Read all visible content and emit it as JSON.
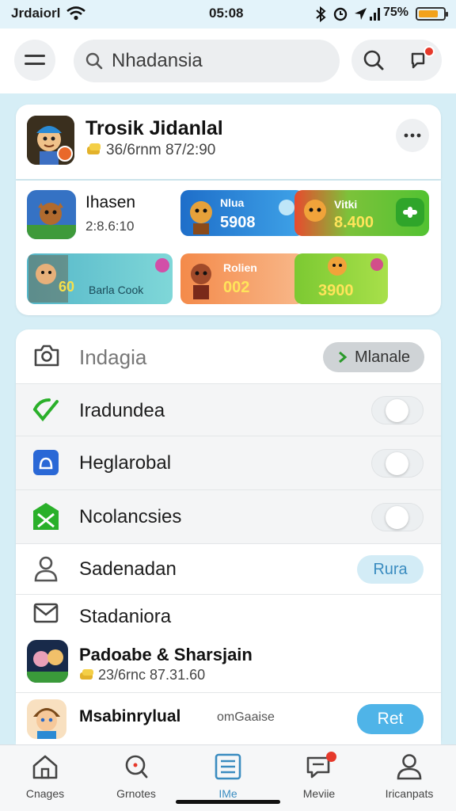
{
  "status_bar": {
    "carrier": "Jrdaiorl",
    "time": "05:08",
    "battery_pct": "75%",
    "battery_level": 0.75
  },
  "header": {
    "search_placeholder": "Nhadansia",
    "icons": [
      "menu-icon",
      "search-icon",
      "notification-icon"
    ]
  },
  "profile": {
    "title": "Trosik Jidanlal",
    "subtitle": "36/6rnm 87/2:90"
  },
  "games": {
    "featured": {
      "title": "Ihasen",
      "subtitle": "2:8.6:10"
    },
    "tiles": [
      {
        "label": "Nlua",
        "value": "5908"
      },
      {
        "label": "Vitki",
        "value": "8.400"
      },
      {
        "label": "Barla Cook",
        "value": "60"
      },
      {
        "label": "Rolien",
        "value": "002"
      },
      {
        "label": "",
        "value": "3900"
      }
    ]
  },
  "settings": {
    "header_label": "Indagia",
    "header_button": "Mlanale",
    "rows": [
      {
        "label": "Iradundea"
      },
      {
        "label": "Heglarobal"
      },
      {
        "label": "Ncolancsies"
      },
      {
        "label": "Sadenadan",
        "button": "Rura"
      },
      {
        "label": "Stadaniora"
      }
    ],
    "app_item": {
      "title": "Padoabe & Sharsjain",
      "subtitle": "23/6rnc 87.31.60"
    },
    "user_item": {
      "title": "Msabinrylual",
      "extra": "omGaaise",
      "button": "Ret"
    }
  },
  "nav": {
    "items": [
      {
        "label": "Cnages"
      },
      {
        "label": "Grnotes"
      },
      {
        "label": "IMe"
      },
      {
        "label": "Meviie"
      },
      {
        "label": "Iricanpats"
      }
    ],
    "active_index": 2
  },
  "colors": {
    "accent": "#3aa0e8",
    "pill_light": "#d3ecf6",
    "pill_solid": "#4fb4e8",
    "notification": "#e6392b",
    "battery": "#f2a21b"
  }
}
